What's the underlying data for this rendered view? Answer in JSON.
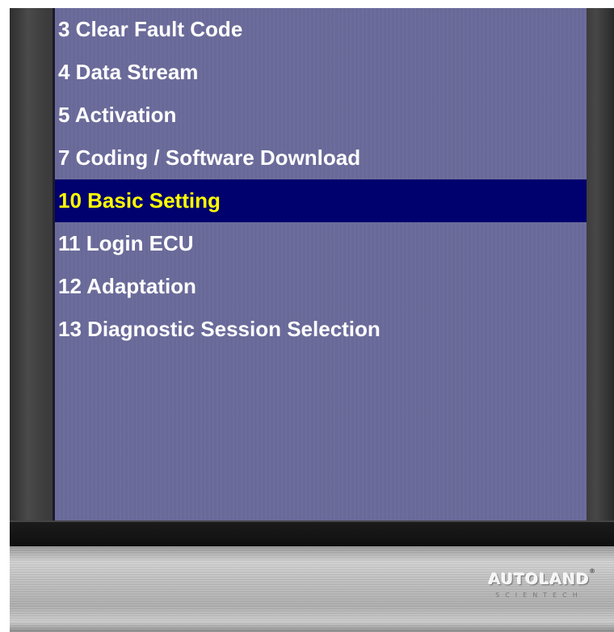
{
  "menu": {
    "items": [
      {
        "label": "3 Clear Fault Code",
        "selected": false
      },
      {
        "label": "4 Data Stream",
        "selected": false
      },
      {
        "label": "5 Activation",
        "selected": false
      },
      {
        "label": "7 Coding / Software Download",
        "selected": false
      },
      {
        "label": "10 Basic Setting",
        "selected": true
      },
      {
        "label": "11 Login ECU",
        "selected": false
      },
      {
        "label": "12 Adaptation",
        "selected": false
      },
      {
        "label": "13 Diagnostic Session Selection",
        "selected": false
      }
    ]
  },
  "brand": {
    "name": "AUTOLAND",
    "tagline": "SCIENTECH",
    "registered": "®"
  },
  "colors": {
    "screen_bg": "#6b6b9b",
    "item_text": "#ffffff",
    "selected_bg": "#00006e",
    "selected_text": "#ffff00"
  }
}
